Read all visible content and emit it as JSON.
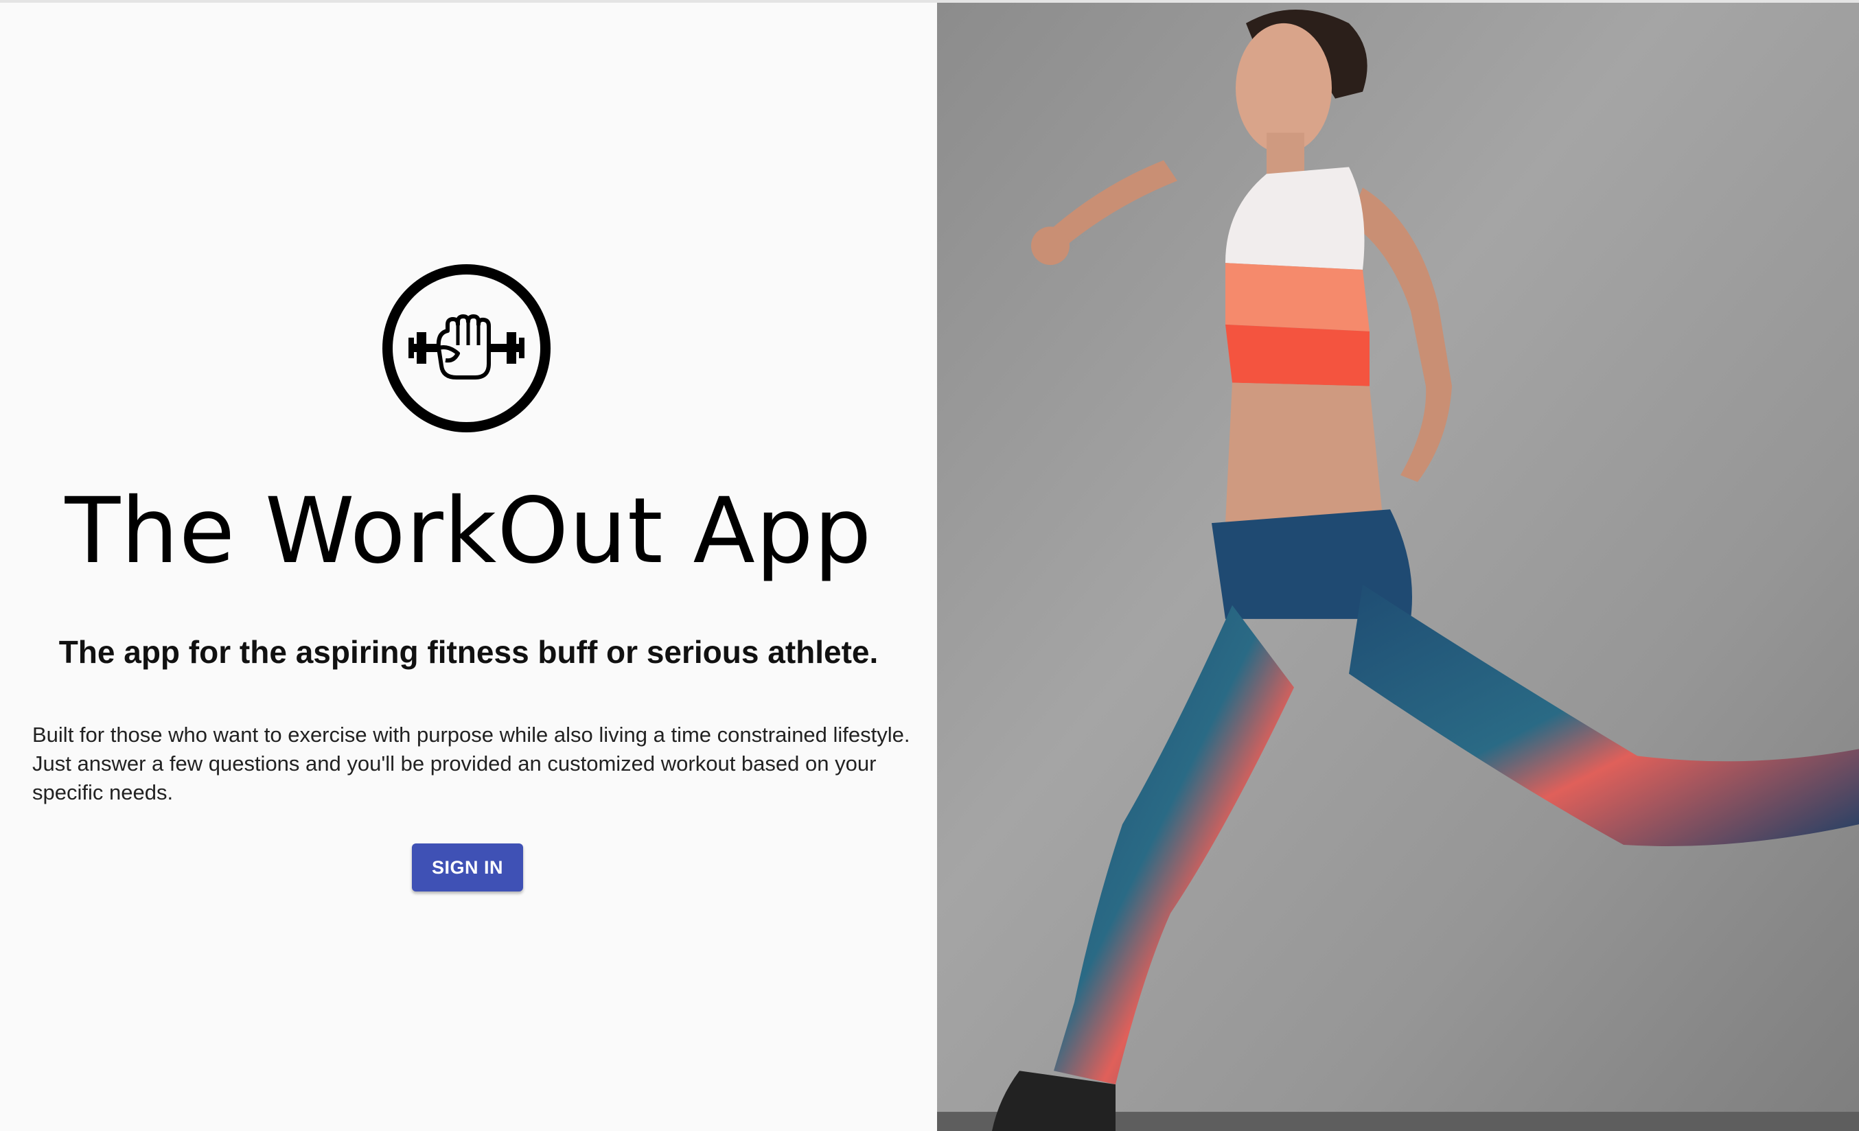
{
  "hero": {
    "logo_icon": "fist-dumbbell-icon",
    "title": "The WorkOut App",
    "tagline": "The app for the aspiring fitness buff or serious athlete.",
    "description": "Built for those who want to exercise with purpose while also living a time constrained lifestyle. Just answer a few questions and you'll be provided an customized workout based on your specific needs.",
    "signin_label": "SIGN IN"
  },
  "image": {
    "subject": "running-athlete-photo"
  },
  "colors": {
    "primary": "#3f51b5",
    "background": "#fafafa",
    "text": "#000000"
  }
}
